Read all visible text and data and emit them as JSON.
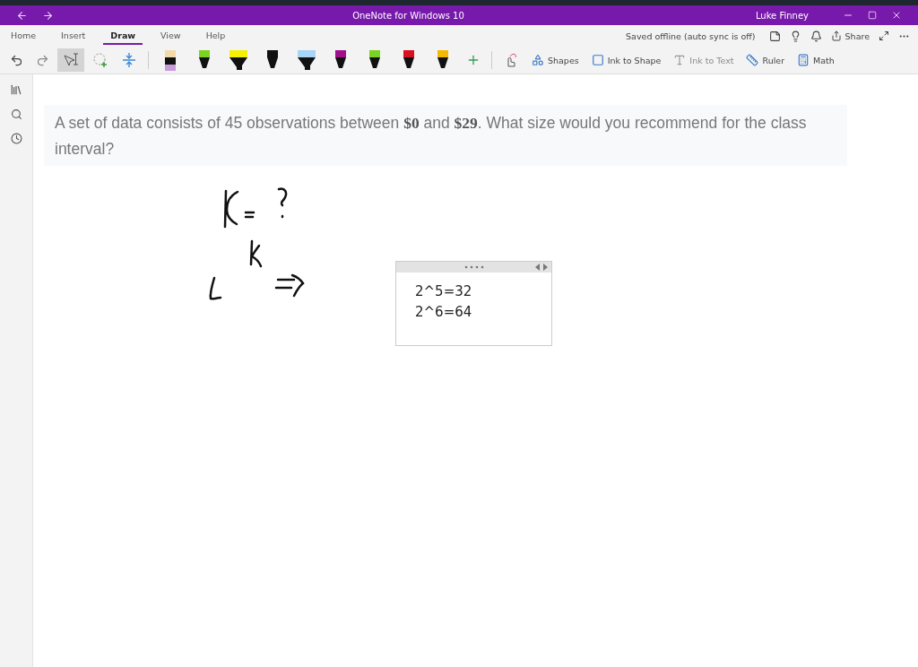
{
  "window": {
    "title": "OneNote for Windows 10",
    "user": "Luke Finney"
  },
  "tabs": [
    {
      "label": "Home",
      "selected": false
    },
    {
      "label": "Insert",
      "selected": false
    },
    {
      "label": "Draw",
      "selected": true
    },
    {
      "label": "View",
      "selected": false
    },
    {
      "label": "Help",
      "selected": false
    }
  ],
  "sync_status": "Saved offline (auto sync is off)",
  "share_label": "Share",
  "pens": [
    {
      "kind": "pencil",
      "color": "#c79ad8"
    },
    {
      "kind": "pen",
      "color": "#7ad321"
    },
    {
      "kind": "highlighter",
      "color": "#f5f000"
    },
    {
      "kind": "pen",
      "color": "#111111"
    },
    {
      "kind": "highlighter",
      "color": "#a8d4f5"
    },
    {
      "kind": "pen",
      "color": "#a0108c"
    },
    {
      "kind": "pen",
      "color": "#7ad321"
    },
    {
      "kind": "pen",
      "color": "#d81020"
    },
    {
      "kind": "pen",
      "color": "#f5b800"
    }
  ],
  "tools": [
    {
      "kind": "shapes",
      "label": "Shapes",
      "disabled": false
    },
    {
      "kind": "ink-to-shape",
      "label": "Ink to Shape",
      "disabled": false
    },
    {
      "kind": "ink-to-text",
      "label": "Ink to Text",
      "disabled": true
    },
    {
      "kind": "ruler",
      "label": "Ruler",
      "disabled": false
    },
    {
      "kind": "math",
      "label": "Math",
      "disabled": false
    }
  ],
  "question": "A set of data consists of 45 observations between **$0** and **$29**. What size would you recommend for the class interval?",
  "note_box": {
    "lines": [
      "2^5=32",
      "2^6=64"
    ]
  }
}
